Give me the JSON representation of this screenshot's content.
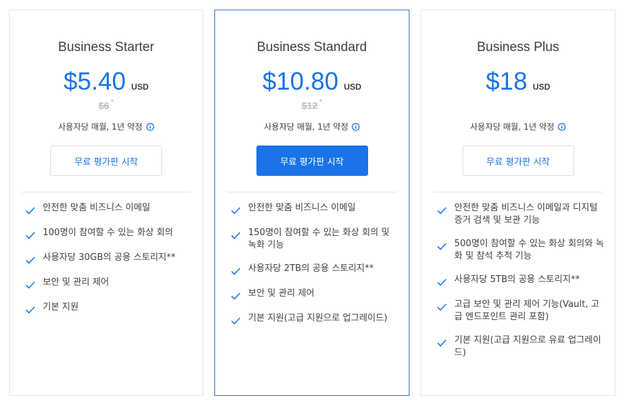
{
  "colors": {
    "accent": "#1a73e8",
    "featured_border": "#3b6fc4",
    "muted": "#b9bcc0",
    "text": "#3c4043"
  },
  "plans": [
    {
      "name": "Business Starter",
      "price": "$5.40",
      "currency": "USD",
      "old_price": "$6",
      "asterisk": "*",
      "billing": "사용자당 매월, 1년 약정",
      "cta": "무료 평가판 시작",
      "features": [
        "안전한 맞춤 비즈니스 이메일",
        "100명이 참여할 수 있는 화상 회의",
        "사용자당 30GB의 공용 스토리지**",
        "보안 및 관리 제어",
        "기본 지원"
      ]
    },
    {
      "name": "Business Standard",
      "price": "$10.80",
      "currency": "USD",
      "old_price": "$12",
      "asterisk": "*",
      "billing": "사용자당 매월, 1년 약정",
      "cta": "무료 평가판 시작",
      "features": [
        "안전한 맞춤 비즈니스 이메일",
        "150명이 참여할 수 있는 화상 회의 및 녹화 기능",
        "사용자당 2TB의 공용 스토리지**",
        "보안 및 관리 제어",
        "기본 지원(고급 지원으로 업그레이드)"
      ]
    },
    {
      "name": "Business Plus",
      "price": "$18",
      "currency": "USD",
      "billing": "사용자당 매월, 1년 약정",
      "cta": "무료 평가판 시작",
      "features": [
        "안전한 맞춤 비즈니스 이메일과 디지털 증거 검색 및 보관 기능",
        "500명이 참여할 수 있는 화상 회의와 녹화 및 참석 추적 기능",
        "사용자당 5TB의 공용 스토리지**",
        "고급 보안 및 관리 제어 기능(Vault, 고급 엔드포인트 관리 포함)",
        "기본 지원(고급 지원으로 유료 업그레이드)"
      ]
    }
  ]
}
